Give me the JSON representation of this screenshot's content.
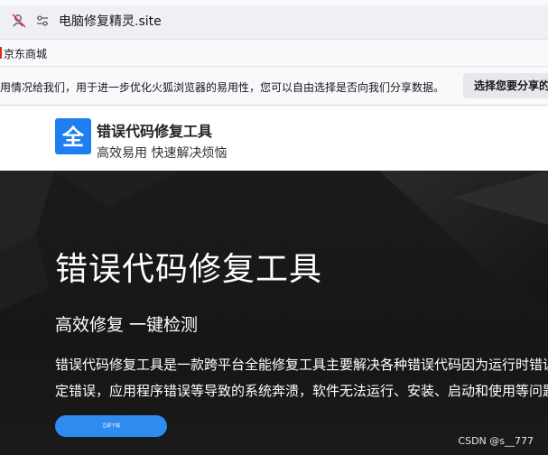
{
  "browser": {
    "url": "电脑修复精灵.site",
    "bookmarks": [
      "京东商城"
    ],
    "notification": {
      "message": "用情况给我们，用于进一步优化火狐浏览器的易用性，您可以自由选择是否向我们分享数据。",
      "button_label": "选择您要分享的"
    }
  },
  "site": {
    "header": {
      "logo_glyph": "全",
      "title": "错误代码修复工具",
      "subtitle": "高效易用 快速解决烦恼"
    },
    "hero": {
      "title": "错误代码修复工具",
      "subtitle": "高效修复 一键检测",
      "desc_line1": "错误代码修复工具是一款跨平台全能修复工具主要解决各种错误代码因为运行时错误",
      "desc_line2": "定错误，应用程序错误等导致的系统奔溃，软件无法运行、安装、启动和使用等问题,",
      "button_label": "立即下载"
    }
  },
  "watermark": "CSDN @s__777",
  "colors": {
    "accent": "#1f7ef0",
    "hero_button": "#2e8cf0",
    "hero_bg": "#1b1b1b"
  },
  "icons": [
    "permissions-icon",
    "connection-icon",
    "bookmark-flag-icon",
    "logo-icon"
  ]
}
